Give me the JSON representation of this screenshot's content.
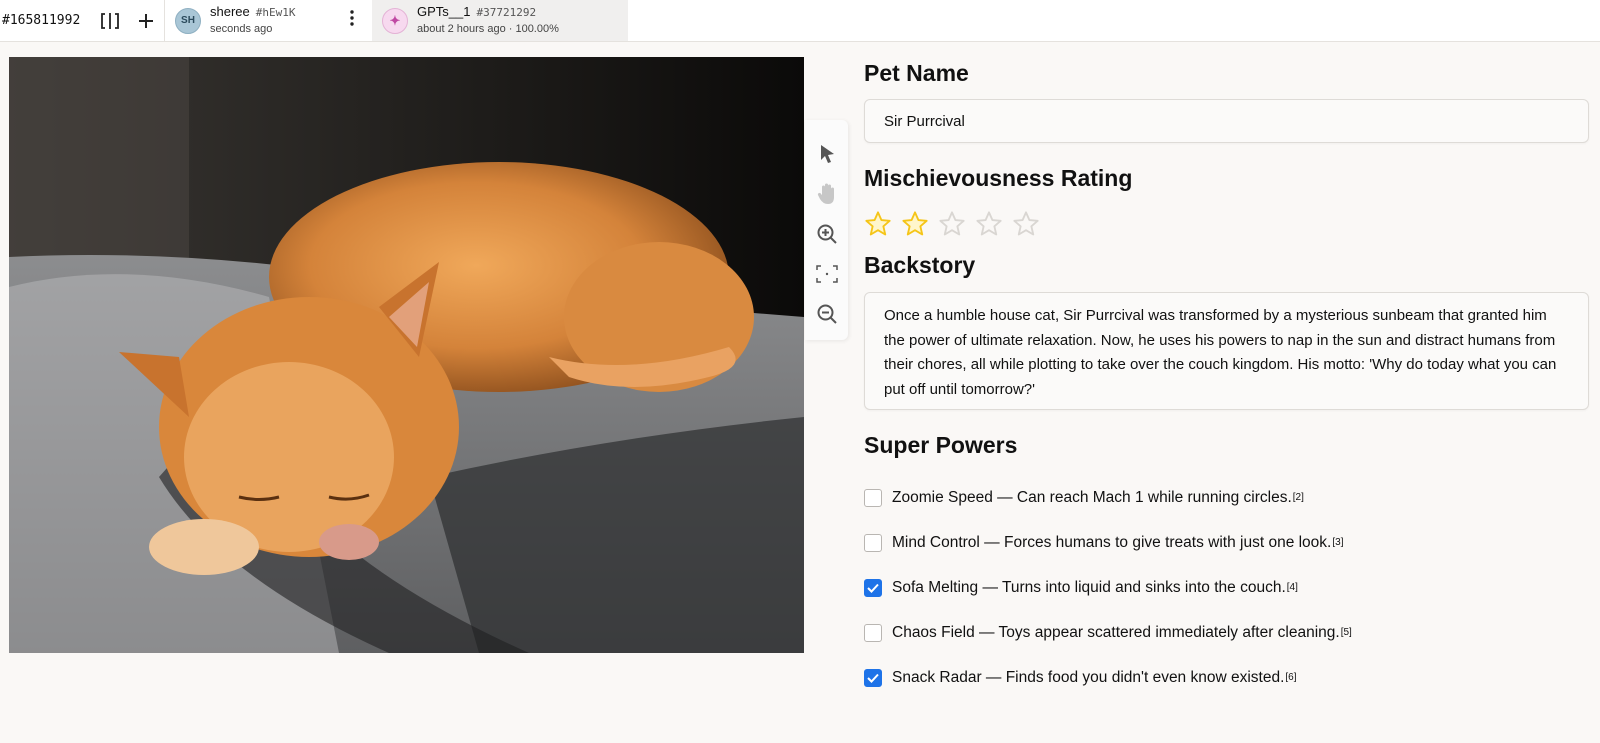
{
  "topbar": {
    "task_id": "#165811992",
    "tabs": [
      {
        "avatar": "SH",
        "title": "sheree",
        "hash": "#hEw1K",
        "subtitle": "seconds ago"
      },
      {
        "avatar": "✦",
        "title": "GPTs__1",
        "hash": "#37721292",
        "subtitle": "about 2 hours ago · 100.00%"
      }
    ]
  },
  "icons": {
    "layout": "split-columns-icon",
    "add": "plus-icon",
    "menu": "kebab-menu-icon",
    "tools": [
      "pointer-icon",
      "hand-icon",
      "zoom-in-icon",
      "fit-screen-icon",
      "zoom-out-icon"
    ]
  },
  "form": {
    "pet_name_label": "Pet Name",
    "pet_name_value": "Sir Purrcival",
    "rating_label": "Mischievousness Rating",
    "rating": {
      "value": 2,
      "max": 5
    },
    "backstory_label": "Backstory",
    "backstory_value": "Once a humble house cat, Sir Purrcival was transformed by a mysterious sunbeam that granted him the power of ultimate relaxation. Now, he uses his powers to nap in the sun and distract humans from their chores, all while plotting to take over the couch kingdom. His motto: 'Why do today what you can put off until tomorrow?'",
    "powers_label": "Super Powers",
    "powers": [
      {
        "label": "Zoomie Speed — Can reach Mach 1 while running circles.",
        "ref": "[2]",
        "checked": false
      },
      {
        "label": "Mind Control — Forces humans to give treats with just one look.",
        "ref": "[3]",
        "checked": false
      },
      {
        "label": "Sofa Melting — Turns into liquid and sinks into the couch.",
        "ref": "[4]",
        "checked": true
      },
      {
        "label": "Chaos Field — Toys appear scattered immediately after cleaning.",
        "ref": "[5]",
        "checked": false
      },
      {
        "label": "Snack Radar — Finds food you didn't even know existed.",
        "ref": "[6]",
        "checked": true
      }
    ]
  },
  "colors": {
    "accent": "#1e73e8",
    "star_filled": "#f5c518",
    "star_empty": "#d9d6d2"
  }
}
